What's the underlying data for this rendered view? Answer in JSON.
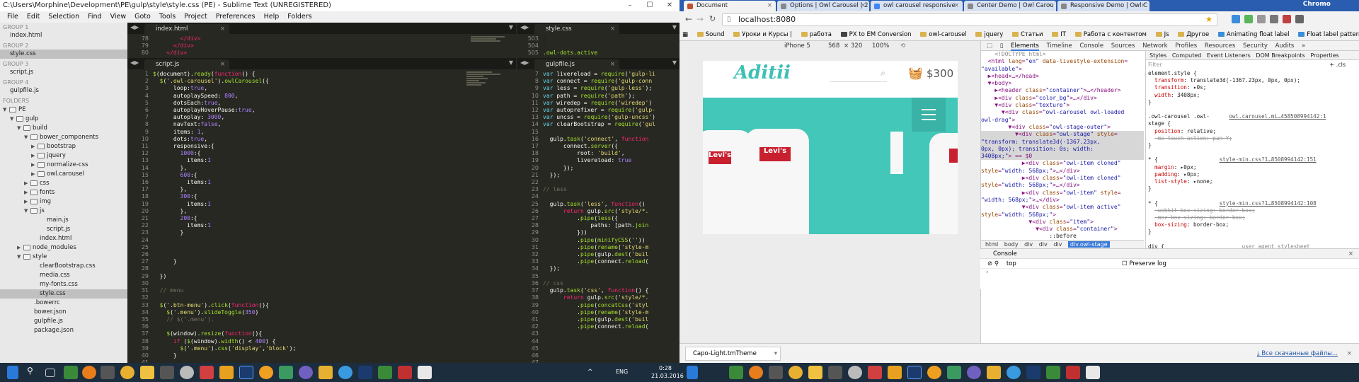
{
  "sublime": {
    "title": "C:\\Users\\Morphine\\Development\\PE\\gulp\\style\\style.css (PE) - Sublime Text (UNREGISTERED)",
    "menu": [
      "File",
      "Edit",
      "Selection",
      "Find",
      "View",
      "Goto",
      "Tools",
      "Project",
      "Preferences",
      "Help",
      "Folders"
    ],
    "sidebar": {
      "groups": [
        {
          "name": "GROUP 1",
          "file": "index.html"
        },
        {
          "name": "GROUP 2",
          "file": "style.css"
        },
        {
          "name": "GROUP 3",
          "file": "script.js"
        },
        {
          "name": "GROUP 4",
          "file": "gulpfile.js"
        }
      ],
      "folders_label": "FOLDERS",
      "tree": [
        "PE",
        "gulp",
        "build",
        "bower_components",
        "bootstrap",
        "jquery",
        "normalize-css",
        "owl.carousel",
        "css",
        "fonts",
        "img",
        "js",
        "main.js",
        "script.js",
        "index.html",
        "node_modules",
        "style",
        "clearBootstrap.css",
        "media.css",
        "my-fonts.css",
        "style.css",
        ".bowerrc",
        "bower.json",
        "gulpfile.js",
        "package.json"
      ]
    },
    "panes": {
      "top_left_tab": "index.html",
      "top_right_tab": "style.css",
      "bottom_left_tab": "script.js",
      "bottom_right_tab": "gulpfile.js",
      "top_left_lines": [
        "78",
        "79",
        "80"
      ],
      "top_right_lines": [
        "503",
        "504",
        "505"
      ],
      "script_lines": [
        "1",
        "2",
        "3",
        "4",
        "5",
        "6",
        "7",
        "8",
        "9",
        "10",
        "11",
        "12",
        "13",
        "14",
        "15",
        "16",
        "17",
        "18",
        "19",
        "20",
        "21",
        "22",
        "23",
        "24",
        "25",
        "26",
        "27",
        "28",
        "29",
        "30",
        "31",
        "32",
        "33",
        "34",
        "35",
        "36",
        "37",
        "38",
        "39",
        "40",
        "41",
        "42",
        "43",
        "44",
        "45"
      ],
      "gulp_lines": [
        "7",
        "8",
        "9",
        "10",
        "11",
        "12",
        "13",
        "14",
        "15",
        "16",
        "17",
        "18",
        "19",
        "20",
        "21",
        "22",
        "23",
        "24",
        "25",
        "26",
        "27",
        "28",
        "29",
        "30",
        "31",
        "32",
        "33",
        "34",
        "35",
        "36",
        "37",
        "38",
        "39",
        "40",
        "41",
        "42",
        "43",
        "44",
        "45",
        "46",
        "47",
        "48",
        "49",
        "50",
        "51"
      ]
    }
  },
  "chrome": {
    "tabs": [
      "Document",
      "Options | Owl Carousel | 2",
      "owl carousel responsive",
      "Center Demo | Owl Carou",
      "Responsive Demo | Owl C"
    ],
    "user": "Chromo",
    "url": "localhost:8080",
    "bookmarks": [
      "Sound",
      "Уроки и Курсы |",
      "работа",
      "PX to EM Conversion",
      "owl-carousel",
      "jquery",
      "Статьи",
      "IT",
      "Работа с контентом",
      "Js",
      "Другое",
      "Animating float label",
      "Float label pattern op"
    ],
    "device": {
      "model": "iPhone 5",
      "width": "568",
      "x": "×",
      "height": "320",
      "zoom": "100%"
    },
    "site": {
      "logo": "Aditii",
      "cart": "$300",
      "levis": "Levi's"
    },
    "devtools": {
      "tabs": [
        "Elements",
        "Timeline",
        "Console",
        "Sources",
        "Network",
        "Profiles",
        "Resources",
        "Security",
        "Audits"
      ],
      "style_tabs": [
        "Styles",
        "Computed",
        "Event Listeners",
        "DOM Breakpoints",
        "Properties"
      ],
      "filter": "Filter",
      "filter_tools": "+  .cls",
      "breadcrumb": [
        "html",
        "body",
        "div",
        "div",
        "div",
        "div.owl-stage"
      ]
    },
    "console": {
      "title": "Console",
      "context": "top",
      "preserve": "Preserve log"
    },
    "download": {
      "file": "Capo-Light.tmTheme",
      "all": "Все скачанные файлы..."
    }
  },
  "taskbar": {
    "lang": "ENG",
    "time": "0:28",
    "date": "21.03.2016"
  }
}
